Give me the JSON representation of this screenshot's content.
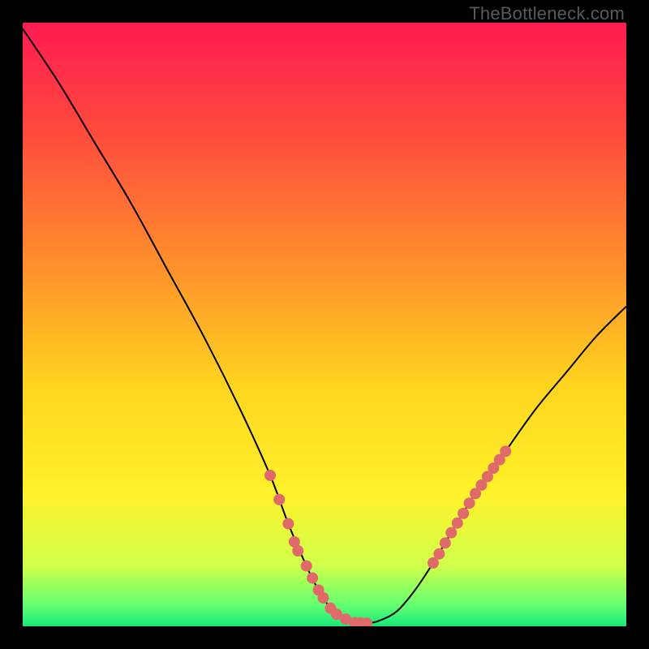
{
  "watermark": "TheBottleneck.com",
  "chart_data": {
    "type": "line",
    "title": "",
    "xlabel": "",
    "ylabel": "",
    "xlim": [
      0,
      100
    ],
    "ylim": [
      0,
      100
    ],
    "grid": false,
    "series": [
      {
        "name": "curve",
        "x": [
          0,
          6,
          12,
          18,
          24,
          30,
          36,
          41,
          44,
          47,
          49,
          51,
          53,
          55,
          57,
          59,
          62,
          65,
          68,
          71,
          75,
          80,
          85,
          90,
          95,
          100
        ],
        "y": [
          99,
          90,
          80,
          70,
          59,
          48,
          36,
          25,
          17,
          10,
          6,
          3,
          1.2,
          0.6,
          0.5,
          0.9,
          2.5,
          6.0,
          10.5,
          15.5,
          22,
          29,
          36,
          42,
          48,
          53
        ]
      },
      {
        "name": "highlight-left",
        "x": [
          41,
          42.5,
          44,
          45,
          45.6,
          47,
          48,
          49,
          49.8,
          51,
          52,
          53.5,
          55,
          56,
          57
        ],
        "y": [
          25,
          21,
          17,
          14,
          12.5,
          10,
          8,
          6,
          4.7,
          3,
          2,
          1.2,
          0.6,
          0.55,
          0.5
        ]
      },
      {
        "name": "highlight-right",
        "x": [
          68,
          69,
          70,
          71,
          72,
          73,
          74,
          75,
          76,
          77,
          78,
          79,
          80
        ],
        "y": [
          10.5,
          12,
          13.8,
          15.5,
          17.1,
          18.7,
          20.4,
          22,
          23.4,
          24.8,
          26.2,
          27.6,
          29
        ]
      }
    ],
    "gradient_stops": [
      {
        "offset": 0.0,
        "color": "#ff1a52"
      },
      {
        "offset": 0.18,
        "color": "#ff4a3d"
      },
      {
        "offset": 0.4,
        "color": "#ff8f2c"
      },
      {
        "offset": 0.6,
        "color": "#ffd41f"
      },
      {
        "offset": 0.78,
        "color": "#fff22a"
      },
      {
        "offset": 0.9,
        "color": "#cfff4a"
      },
      {
        "offset": 0.965,
        "color": "#63ff70"
      },
      {
        "offset": 1.0,
        "color": "#17e87a"
      }
    ],
    "marker_color": "#e06a6a",
    "marker_radius": 7
  }
}
